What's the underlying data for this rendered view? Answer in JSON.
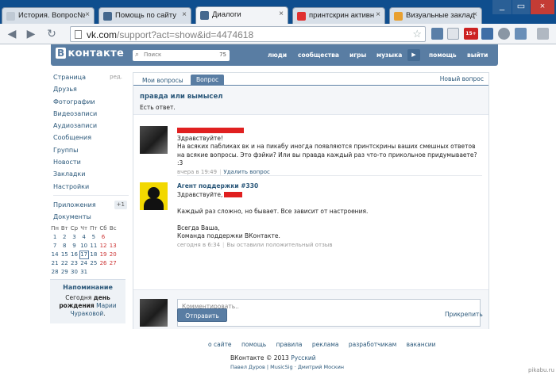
{
  "browser": {
    "tabs": [
      {
        "title": "История. Вопрос№",
        "active": false,
        "favicon_color": "#bfc9d4"
      },
      {
        "title": "Помощь по сайту",
        "active": false,
        "favicon_color": "#45688e"
      },
      {
        "title": "Диалоги",
        "active": true,
        "favicon_color": "#45688e"
      },
      {
        "title": "принтскрин активн",
        "active": false,
        "favicon_color": "#e03030"
      },
      {
        "title": "Визуальные заклад",
        "active": false,
        "favicon_color": "#e8a030"
      }
    ],
    "close_glyph": "×",
    "address": {
      "host": "vk.com",
      "path": "/support?act=show&id=4474618"
    },
    "back_icon": "arrow-left-icon",
    "forward_icon": "arrow-right-icon",
    "reload_icon": "reload-icon",
    "ext_badge": "15+"
  },
  "vk": {
    "logo_b": "В",
    "logo_text": "контакте",
    "search_placeholder": "Поиск",
    "search_count": "75",
    "nav": [
      "люди",
      "сообщества",
      "игры",
      "музыка",
      "помощь",
      "выйти"
    ],
    "play_glyph": "▶",
    "sidebar": [
      {
        "label": "Страница",
        "extra": "ред."
      },
      {
        "label": "Друзья"
      },
      {
        "label": "Фотографии"
      },
      {
        "label": "Видеозаписи"
      },
      {
        "label": "Аудиозаписи"
      },
      {
        "label": "Сообщения"
      },
      {
        "label": "Группы"
      },
      {
        "label": "Новости"
      },
      {
        "label": "Закладки"
      },
      {
        "label": "Настройки"
      }
    ],
    "sidebar2": [
      {
        "label": "Приложения",
        "badge": "+1"
      },
      {
        "label": "Документы"
      }
    ],
    "calendar": {
      "headers": [
        "Пн",
        "Вт",
        "Ср",
        "Чт",
        "Пт",
        "Сб",
        "Вс"
      ],
      "weeks": [
        [
          "1",
          "2",
          "3",
          "4",
          "5",
          "6",
          ""
        ],
        [
          "7",
          "8",
          "9",
          "10",
          "11",
          "12",
          "13"
        ],
        [
          "14",
          "15",
          "16",
          "17",
          "18",
          "19",
          "20"
        ],
        [
          "21",
          "22",
          "23",
          "24",
          "25",
          "26",
          "27"
        ],
        [
          "28",
          "29",
          "30",
          "31",
          "",
          "",
          ""
        ]
      ],
      "today": "17"
    },
    "reminder": {
      "title": "Напоминание",
      "line1": "Сегодня ",
      "bold": "день рождения",
      "name": "Марии Чураковой",
      "end": "."
    },
    "tabs": {
      "my_questions": "Мои вопросы",
      "question": "Вопрос",
      "new_question": "Новый вопрос"
    },
    "question": {
      "title": "правда или вымысел",
      "status": "Есть ответ."
    },
    "user_post": {
      "line1": "Здравствуйте!",
      "body": "На всяких пабликах вк и на пикабу иногда появляются принтскрины ваших смешных ответов на всякие вопросы. Это фэйки? Или вы правда каждый раз что-то прикольное придумываете? :3",
      "time": "вчера в 19:49",
      "delete": "Удалить вопрос"
    },
    "agent_post": {
      "author": "Агент поддержки #330",
      "greeting": "Здравствуйте,",
      "body": "Каждый раз сложно, но бывает. Все зависит от настроения.",
      "sign1": "Всегда Ваша,",
      "sign2": "Команда поддержки ВКонтакте.",
      "time": "сегодня в 6:34",
      "feedback": "Вы оставили положительный отзыв"
    },
    "reply": {
      "placeholder": "Комментировать..",
      "send": "Отправить",
      "attach": "Прикрепить"
    },
    "footer": {
      "links": [
        "о сайте",
        "помощь",
        "правила",
        "реклама",
        "разработчикам",
        "вакансии"
      ],
      "copy": "ВКонтакте © 2013",
      "lang": "Русский",
      "authors": "Павел Дуров | MusicSig · Дмитрий Москин"
    }
  },
  "watermark": "pikabu.ru"
}
